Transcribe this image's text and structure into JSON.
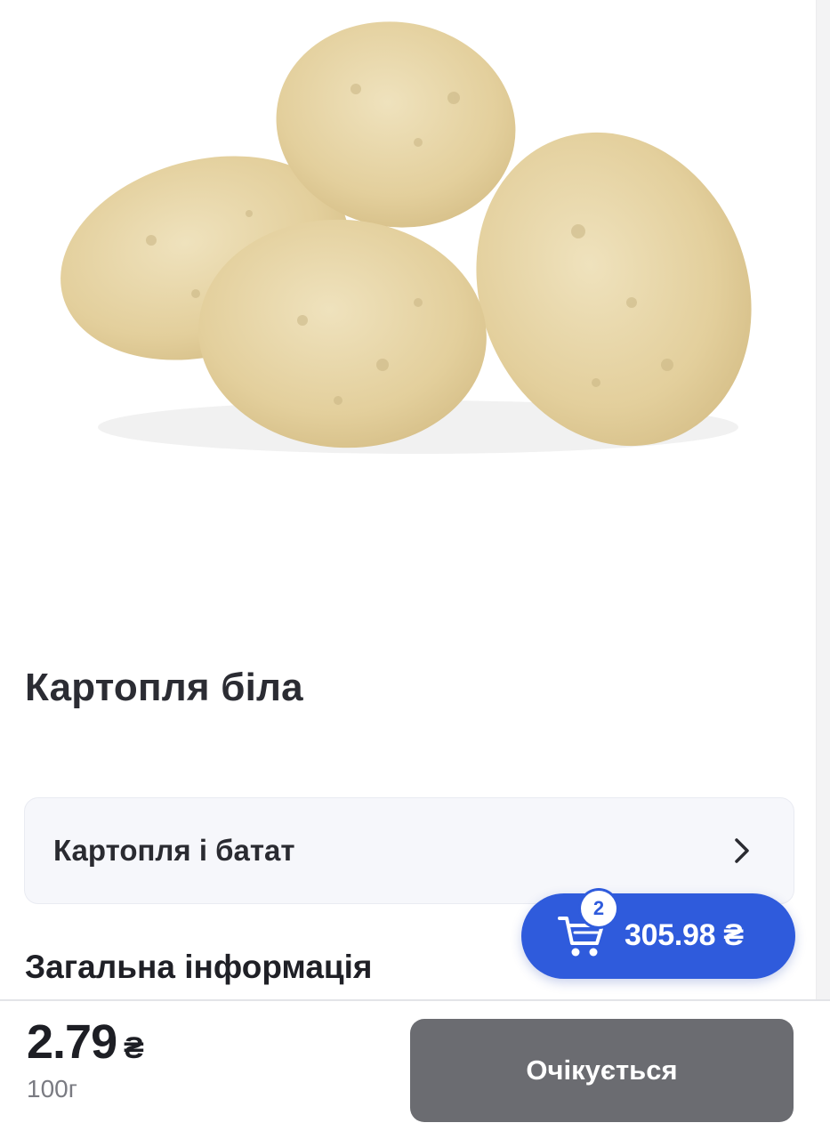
{
  "product": {
    "title": "Картопля біла",
    "image_icon": "potatoes-image"
  },
  "category": {
    "label": "Картопля і батат",
    "icon": "chevron-right-icon"
  },
  "section": {
    "general_info": "Загальна інформація"
  },
  "cart": {
    "icon": "cart-icon",
    "badge_count": "2",
    "total": "305.98 ₴",
    "color": "#2f5bdc"
  },
  "bottom_bar": {
    "price": "2.79",
    "currency": "₴",
    "unit": "100г",
    "action_label": "Очікується",
    "action_color": "#6b6c71"
  }
}
